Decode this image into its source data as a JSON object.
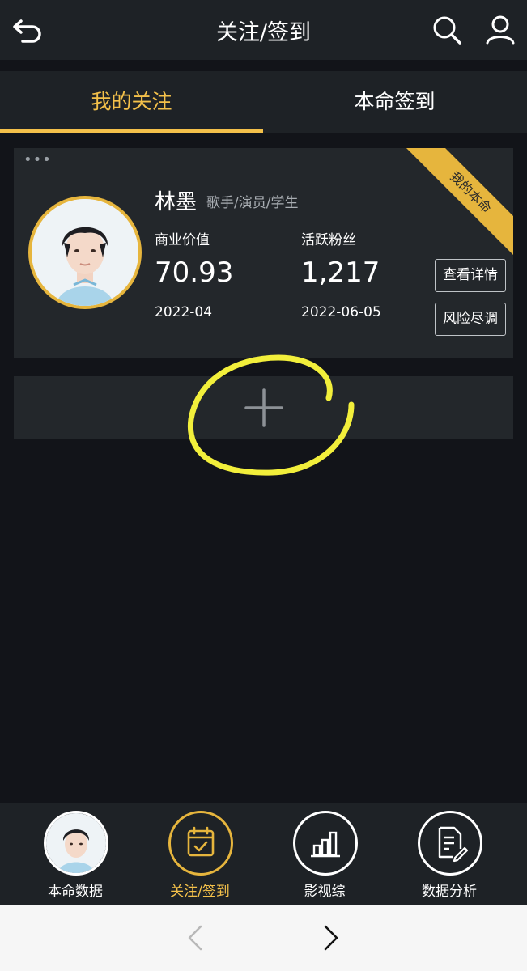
{
  "header": {
    "title": "关注/签到",
    "back_icon": "back-arrow-icon",
    "search_icon": "search-icon",
    "user_icon": "user-icon"
  },
  "tabs": [
    {
      "label": "我的关注",
      "active": true
    },
    {
      "label": "本命签到",
      "active": false
    }
  ],
  "card": {
    "more_icon": "more-dots-icon",
    "ribbon": "我的本命",
    "name": "林墨",
    "roles": "歌手/演员/学生",
    "stats": [
      {
        "label": "商业价值",
        "value": "70.93",
        "date": "2022-04"
      },
      {
        "label": "活跃粉丝",
        "value": "1,217",
        "date": "2022-06-05"
      }
    ],
    "buttons": {
      "details": "查看详情",
      "risk": "风险尽调"
    }
  },
  "add": {
    "icon": "plus-icon"
  },
  "bottom_nav": [
    {
      "label": "本命数据",
      "icon": "avatar",
      "active": false
    },
    {
      "label": "关注/签到",
      "icon": "calendar-check-icon",
      "active": true
    },
    {
      "label": "影视综",
      "icon": "bar-chart-icon",
      "active": false
    },
    {
      "label": "数据分析",
      "icon": "document-edit-icon",
      "active": false
    }
  ],
  "browser": {
    "prev_icon": "chevron-left-icon",
    "next_icon": "chevron-right-icon"
  },
  "colors": {
    "accent": "#f3c04a",
    "background": "#121419",
    "panel": "#23272b"
  }
}
